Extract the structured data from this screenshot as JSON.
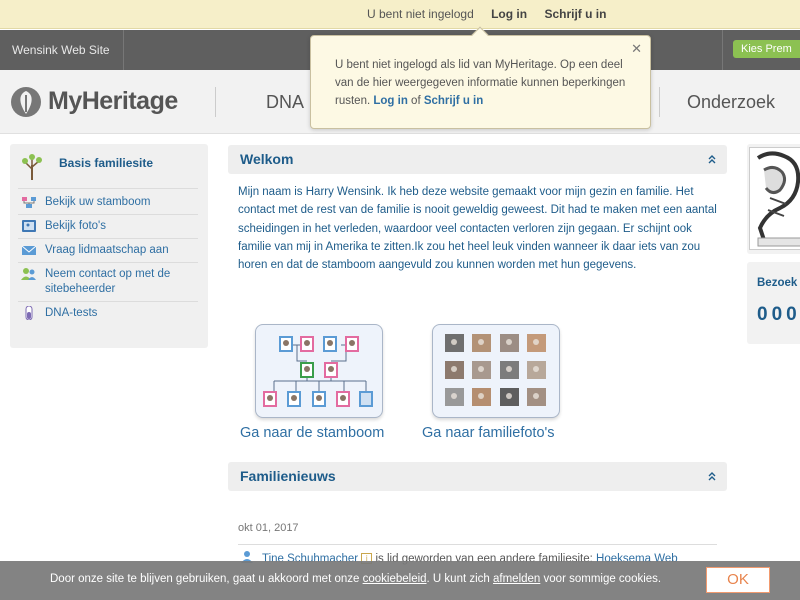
{
  "topbar": {
    "status": "U bent niet ingelogd",
    "login": "Log in",
    "signup": "Schrijf u in"
  },
  "sitebar": {
    "site_name": "Wensink Web Site",
    "premium": "Kies Prem"
  },
  "header": {
    "logo": "MyHeritage",
    "nav": [
      "DNA",
      "Onderzoek"
    ]
  },
  "popup": {
    "text_before": "U bent niet ingelogd als lid van MyHeritage. Op een deel van de hier weergegeven informatie kunnen beperkingen rusten. ",
    "login": "Log in",
    "middle": " of ",
    "signup": "Schrijf u in"
  },
  "sidebar": {
    "title": "Basis familiesite",
    "items": [
      {
        "label": "Bekijk uw stamboom",
        "icon": "family-tree-icon"
      },
      {
        "label": "Bekijk foto's",
        "icon": "photos-icon"
      },
      {
        "label": "Vraag lidmaatschap aan",
        "icon": "envelope-icon"
      },
      {
        "label": "Neem contact op met de sitebeheerder",
        "icon": "contact-admin-icon"
      },
      {
        "label": "DNA-tests",
        "icon": "dna-tube-icon"
      }
    ]
  },
  "welcome": {
    "title": "Welkom",
    "text": "Mijn naam is Harry Wensink. Ik heb deze website gemaakt voor mijn gezin en familie. Het contact met de rest van de familie is nooit geweldig geweest. Dit had te maken met een aantal scheidingen in het verleden, waardoor veel contacten verloren zijn gegaan. Er schijnt ook familie van mij in Amerika te zitten.Ik zou het heel leuk vinden wanneer ik daar iets van zou horen en dat de stamboom aangevuld zou kunnen worden met hun gegevens.",
    "tree_link": "Ga naar de stamboom",
    "photos_link": "Ga naar familiefoto's"
  },
  "news": {
    "title": "Familienieuws",
    "date": "okt 01, 2017",
    "item_name": "Tine Schuhmacher",
    "item_text": " is lid geworden van een andere familiesite: ",
    "item_site": "Hoeksema Web"
  },
  "right": {
    "visitors_label": "Bezoek",
    "visitors_count": "000"
  },
  "cookie": {
    "text1": "Door onze site te blijven gebruiken, gaat u akkoord met onze ",
    "link1": "cookiebeleid",
    "text2": ". U kunt zich ",
    "link2": "afmelden",
    "text3": " voor sommige cookies.",
    "ok": "OK"
  },
  "colors": {
    "accent": "#1e5c8a",
    "link": "#2f6fa3",
    "premium": "#8cc152"
  }
}
